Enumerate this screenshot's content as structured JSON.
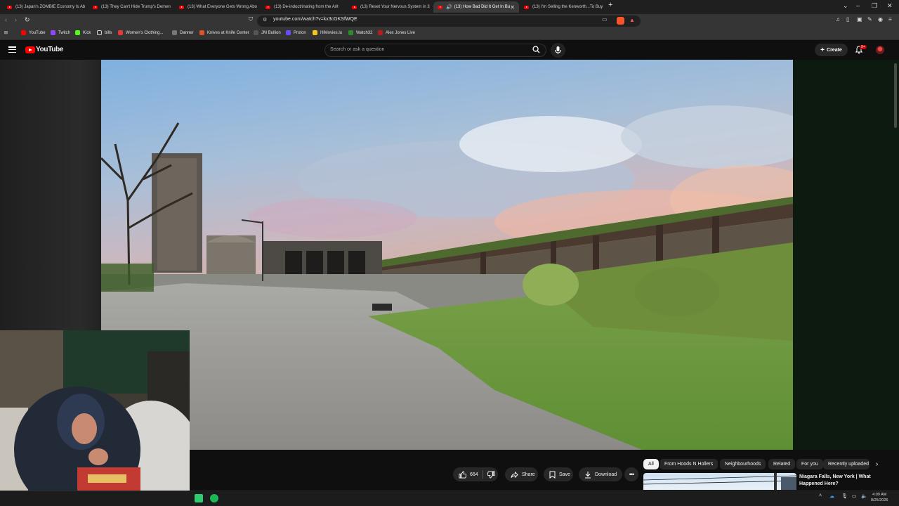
{
  "browser": {
    "tabs": [
      {
        "label": "(13) Japan's ZOMBIE Economy Is Ab"
      },
      {
        "label": "(13) They Can't Hide Trump's Demen"
      },
      {
        "label": "(13) What Everyone Gets Wrong Abo"
      },
      {
        "label": "(13) De-indoctrinating from the Arit"
      },
      {
        "label": "(13) Reset Your Nervous System in 3"
      },
      {
        "label": "(13) How Bad Did It Get In Bu"
      },
      {
        "label": "(13) I'm Selling the Kenworth...To Buy"
      }
    ],
    "url": "youtube.com/watch?v=kx3cGKSfWQE",
    "bookmarks": [
      {
        "label": "YouTube",
        "color": "#ff0000"
      },
      {
        "label": "Twitch",
        "color": "#9146ff"
      },
      {
        "label": "Kick",
        "color": "#53fc18"
      },
      {
        "label": "bills",
        "color": "#cfcfcf"
      },
      {
        "label": "Women's Clothing...",
        "color": "#e03a3a"
      },
      {
        "label": "Danner",
        "color": "#777777"
      },
      {
        "label": "Knives at Knife Center",
        "color": "#d9532b"
      },
      {
        "label": "JM Bullion",
        "color": "#555555"
      },
      {
        "label": "Proton",
        "color": "#6d4aff"
      },
      {
        "label": "HiMovies.lu",
        "color": "#f5c518"
      },
      {
        "label": "Watch32",
        "color": "#2d8a2d"
      },
      {
        "label": "Alex Jones Live",
        "color": "#b51c1c"
      }
    ]
  },
  "youtube": {
    "logo_text": "YouTube",
    "search_placeholder": "Search or ask a question",
    "create_label": "Create",
    "notification_count": "9+"
  },
  "actions": {
    "like_count": "664",
    "share_label": "Share",
    "save_label": "Save",
    "download_label": "Download"
  },
  "chips": [
    "All",
    "From Hoods N Hollers",
    "Neighbourhoods",
    "Related",
    "For you",
    "Recently uploaded"
  ],
  "recommendation": {
    "title": "Niagara Falls, New York | What Happened Here?"
  },
  "taskbar": {
    "time": "4:09 AM",
    "date": "8/25/2026"
  }
}
